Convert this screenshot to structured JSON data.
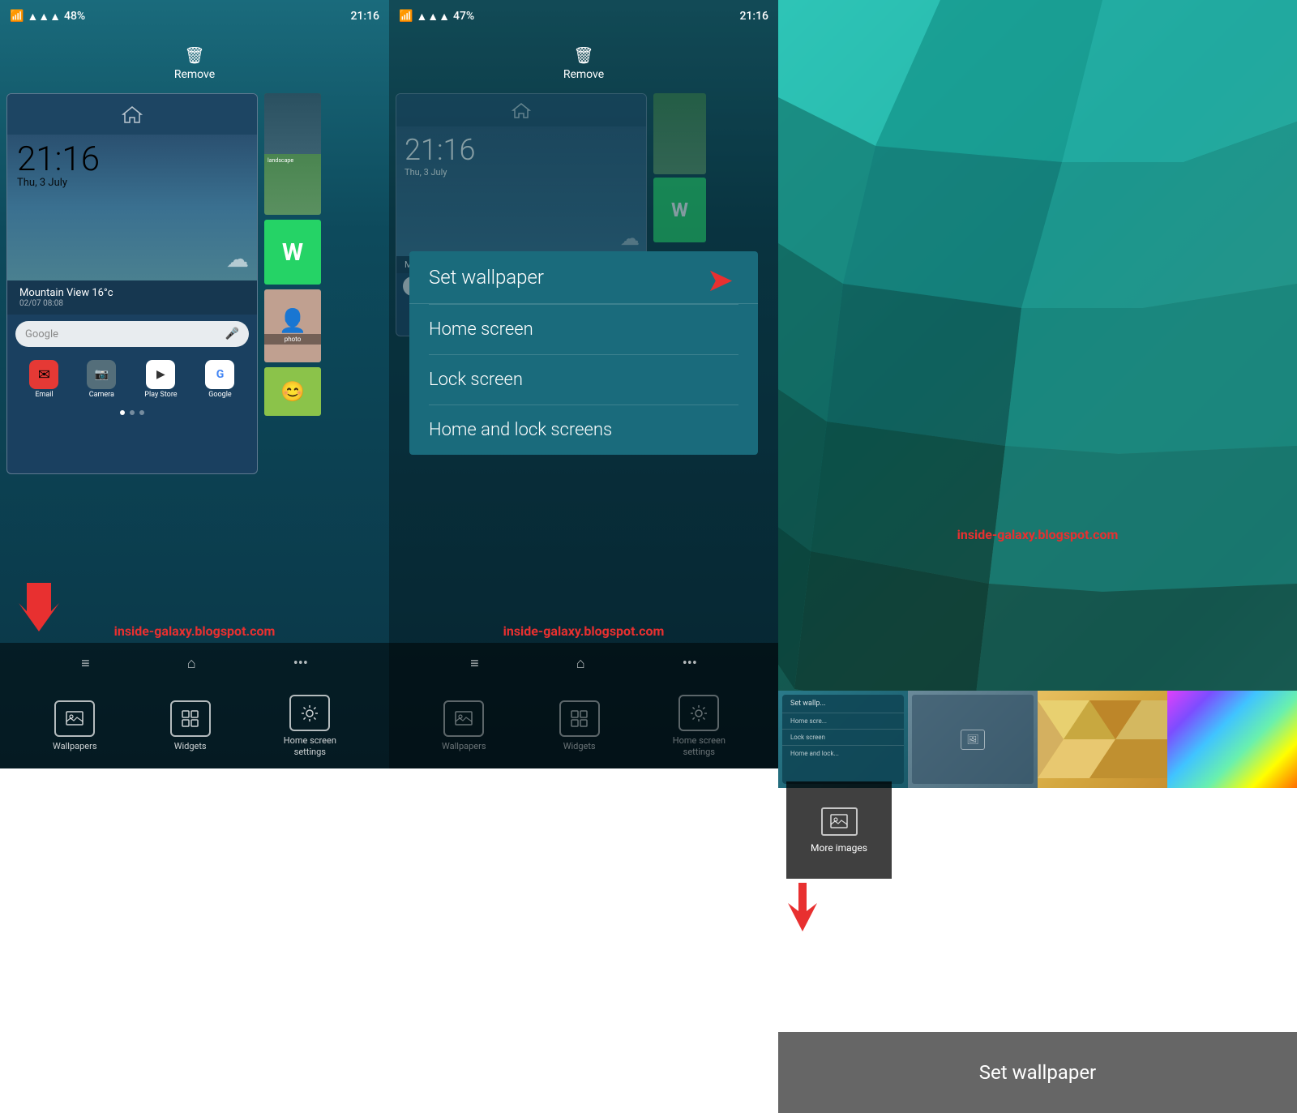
{
  "panel1": {
    "status": {
      "time": "21:16",
      "battery": "48%",
      "signal": "▲▲▲▲"
    },
    "remove_label": "Remove",
    "clock": "21:16",
    "date": "Thu, 3 July",
    "weather": "Mountain View  16°c",
    "weather_time": "02/07 08:08",
    "google_placeholder": "Google",
    "apps": [
      {
        "label": "Email",
        "color": "#e53935",
        "icon": "✉"
      },
      {
        "label": "Camera",
        "color": "#546e7a",
        "icon": "📷"
      },
      {
        "label": "Play Store",
        "color": "#ffffff",
        "icon": "▶"
      },
      {
        "label": "Google",
        "color": "#ffffff",
        "icon": "G"
      }
    ],
    "bottom_items": [
      {
        "label": "Wallpapers",
        "icon": "🖼"
      },
      {
        "label": "Widgets",
        "icon": "⊞"
      },
      {
        "label": "Home screen\nsettings",
        "icon": "⚙"
      }
    ],
    "watermark": "inside-galaxy.blogspot.com"
  },
  "panel2": {
    "status": {
      "time": "21:16",
      "battery": "47%"
    },
    "remove_label": "Remove",
    "clock": "21:16",
    "date": "Thu, 3 July",
    "menu": {
      "set_wallpaper": "Set wallpaper",
      "home_screen": "Home screen",
      "lock_screen": "Lock screen",
      "home_and_lock": "Home and lock screens"
    },
    "bottom_items": [
      {
        "label": "Wallpapers",
        "icon": "🖼"
      },
      {
        "label": "Widgets",
        "icon": "⊞"
      },
      {
        "label": "Home screen\nsettings",
        "icon": "⚙"
      }
    ],
    "watermark": "inside-galaxy.blogspot.com"
  },
  "panel3": {
    "more_images": "More images",
    "set_wallpaper": "Set wallpaper",
    "watermark": "inside-galaxy.blogspot.com"
  }
}
